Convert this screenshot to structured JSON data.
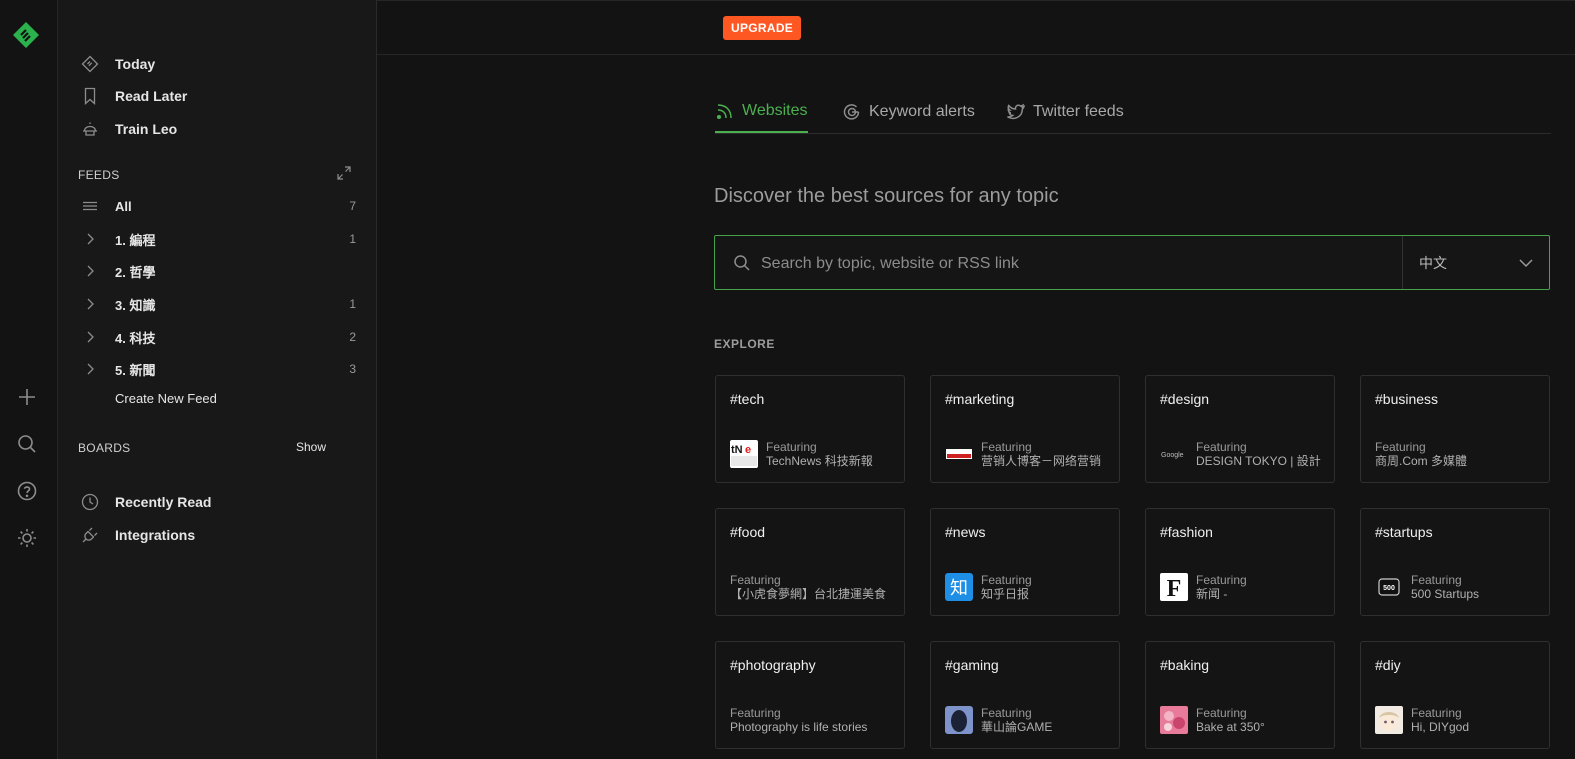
{
  "rail": {
    "icons": [
      "feedly-logo",
      "plus-icon",
      "search-icon",
      "help-icon",
      "sun-icon"
    ]
  },
  "sidebar": {
    "nav": [
      {
        "label": "Today",
        "icon": "today-icon"
      },
      {
        "label": "Read Later",
        "icon": "bookmark-icon"
      },
      {
        "label": "Train Leo",
        "icon": "leo-icon"
      }
    ],
    "feeds_title": "FEEDS",
    "feeds": [
      {
        "label": "All",
        "count": "7"
      },
      {
        "label": "1. 編程",
        "count": "1"
      },
      {
        "label": "2. 哲學",
        "count": ""
      },
      {
        "label": "3. 知識",
        "count": "1"
      },
      {
        "label": "4. 科技",
        "count": "2"
      },
      {
        "label": "5. 新聞",
        "count": "3"
      }
    ],
    "create_feed": "Create New Feed",
    "boards_title": "BOARDS",
    "boards_show": "Show",
    "bottom": [
      {
        "label": "Recently Read",
        "icon": "clock-icon"
      },
      {
        "label": "Integrations",
        "icon": "plug-icon"
      }
    ]
  },
  "topbar": {
    "upgrade": "UPGRADE"
  },
  "tabs": [
    {
      "label": "Websites",
      "icon": "rss-icon",
      "active": true
    },
    {
      "label": "Keyword alerts",
      "icon": "google-icon",
      "active": false
    },
    {
      "label": "Twitter feeds",
      "icon": "twitter-icon",
      "active": false
    }
  ],
  "main": {
    "heading": "Discover the best sources for any topic",
    "search_placeholder": "Search by topic, website or RSS link",
    "language": "中文",
    "explore": "EXPLORE"
  },
  "cards": [
    {
      "tag": "#tech",
      "featuring": "Featuring",
      "source": "TechNews 科技新報"
    },
    {
      "tag": "#marketing",
      "featuring": "Featuring",
      "source": "营销人博客－网络营销"
    },
    {
      "tag": "#design",
      "featuring": "Featuring",
      "source": "DESIGN TOKYO | 設計"
    },
    {
      "tag": "#business",
      "featuring": "Featuring",
      "source": "商周.Com 多媒體"
    },
    {
      "tag": "#food",
      "featuring": "Featuring",
      "source": "【小虎食夢網】台北捷運美食"
    },
    {
      "tag": "#news",
      "featuring": "Featuring",
      "source": "知乎日报"
    },
    {
      "tag": "#fashion",
      "featuring": "Featuring",
      "source": "新闻 -"
    },
    {
      "tag": "#startups",
      "featuring": "Featuring",
      "source": "500 Startups"
    },
    {
      "tag": "#photography",
      "featuring": "Featuring",
      "source": "Photography is life stories"
    },
    {
      "tag": "#gaming",
      "featuring": "Featuring",
      "source": "華山論GAME"
    },
    {
      "tag": "#baking",
      "featuring": "Featuring",
      "source": "Bake at 350°"
    },
    {
      "tag": "#diy",
      "featuring": "Featuring",
      "source": "Hi, DIYgod"
    }
  ],
  "colors": {
    "accent": "#4caf50",
    "upgrade": "#ff5722",
    "background": "#131313",
    "sidebar": "#181818"
  }
}
